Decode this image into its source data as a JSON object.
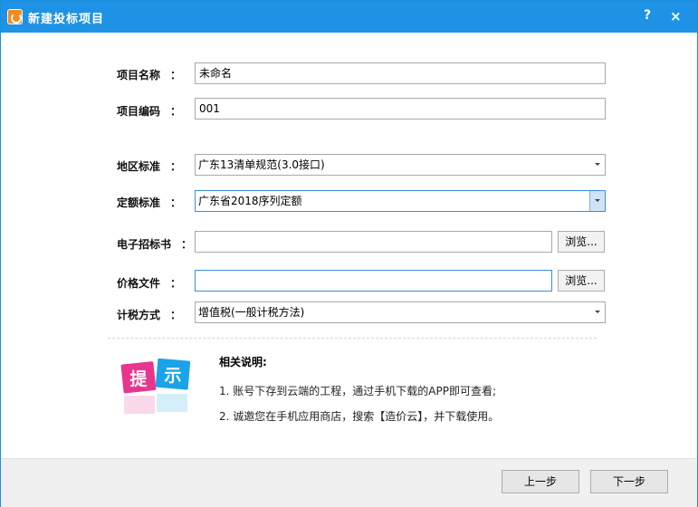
{
  "window": {
    "title": "新建投标项目",
    "help_label": "?",
    "close_label": "×"
  },
  "form": {
    "name_label": "项目名称",
    "name_value": "未命名",
    "code_label": "项目编码",
    "code_value": "001",
    "region_label": "地区标准",
    "region_value": "广东13清单规范(3.0接口)",
    "quota_label": "定额标准",
    "quota_value": "广东省2018序列定额",
    "bid_doc_label": "电子招标书",
    "bid_doc_value": "",
    "price_file_label": "价格文件",
    "price_file_value": "",
    "tax_label": "计税方式",
    "tax_value": "增值税(一般计税方法)",
    "colon": "：",
    "browse_label": "浏览..."
  },
  "notes": {
    "image_text": "提示",
    "title": "相关说明:",
    "items": [
      "1. 账号下存到云端的工程，通过手机下载的APP即可查看;",
      "2. 诚邀您在手机应用商店，搜索【造价云】，并下载使用。"
    ]
  },
  "footer": {
    "prev_label": "上一步",
    "next_label": "下一步"
  },
  "colors": {
    "titlebar": "#1e93e6",
    "focus_border": "#3c8de0",
    "tip_pink": "#e8358d",
    "tip_blue": "#1aa3e8"
  }
}
